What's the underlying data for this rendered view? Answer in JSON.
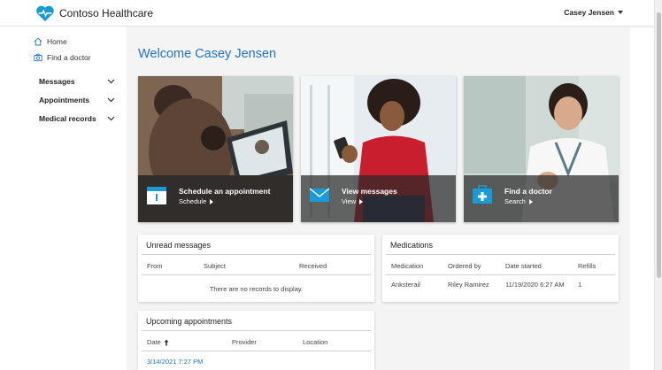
{
  "header": {
    "brand_name": "Contoso Healthcare",
    "user_name": "Casey Jensen"
  },
  "sidebar": {
    "links": [
      {
        "label": "Home",
        "icon": "home-icon"
      },
      {
        "label": "Find a doctor",
        "icon": "camera-icon"
      }
    ],
    "groups": [
      {
        "label": "Messages",
        "icon": "chevron-down-icon"
      },
      {
        "label": "Appointments",
        "icon": "chevron-down-icon"
      },
      {
        "label": "Medical records",
        "icon": "chevron-down-icon"
      }
    ]
  },
  "main": {
    "welcome": "Welcome Casey Jensen",
    "tiles": [
      {
        "title": "Schedule an appointment",
        "subtitle": "Schedule",
        "icon": "calendar-icon"
      },
      {
        "title": "View messages",
        "subtitle": "View",
        "icon": "envelope-icon"
      },
      {
        "title": "Find a doctor",
        "subtitle": "Search",
        "icon": "medical-kit-icon"
      }
    ],
    "unread_messages": {
      "title": "Unread messages",
      "columns": [
        "From",
        "Subject",
        "Received"
      ],
      "empty_text": "There are no records to display."
    },
    "medications": {
      "title": "Medications",
      "columns": [
        "Medication",
        "Ordered by",
        "Date started",
        "Refills"
      ],
      "rows": [
        [
          "Anksterail",
          "Riley Ramirez",
          "11/19/2020 6:27 AM",
          "1"
        ]
      ]
    },
    "upcoming_appointments": {
      "title": "Upcoming appointments",
      "columns": [
        "Date",
        "Provider",
        "Location"
      ],
      "sort_icon": "arrow-up-icon",
      "rows": [
        [
          "3/14/2021 7:27 PM",
          "",
          ""
        ]
      ]
    }
  },
  "colors": {
    "accent": "#2172c9",
    "background": "#f4f4f4",
    "logo": "#1a9ad6"
  }
}
